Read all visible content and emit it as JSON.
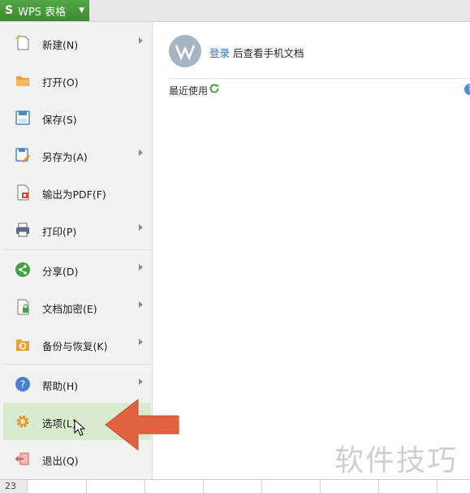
{
  "app": {
    "logo": "S",
    "name": "WPS 表格"
  },
  "menu": {
    "items": [
      {
        "label": "新建(N)"
      },
      {
        "label": "打开(O)"
      },
      {
        "label": "保存(S)"
      },
      {
        "label": "另存为(A)"
      },
      {
        "label": "输出为PDF(F)"
      },
      {
        "label": "打印(P)"
      },
      {
        "label": "分享(D)"
      },
      {
        "label": "文档加密(E)"
      },
      {
        "label": "备份与恢复(K)"
      },
      {
        "label": "帮助(H)"
      },
      {
        "label": "选项(L)"
      },
      {
        "label": "退出(Q)"
      }
    ]
  },
  "panel": {
    "login_link": "登录",
    "login_text": "后查看手机文档",
    "recent_label": "最近使用",
    "help_glyph": "?"
  },
  "grid": {
    "row_number": "23"
  },
  "watermark": "软件技巧",
  "colors": {
    "accent": "#4a9b3a",
    "hover": "#d9ebce",
    "link": "#2a73b7",
    "arrow": "#e0623f"
  }
}
